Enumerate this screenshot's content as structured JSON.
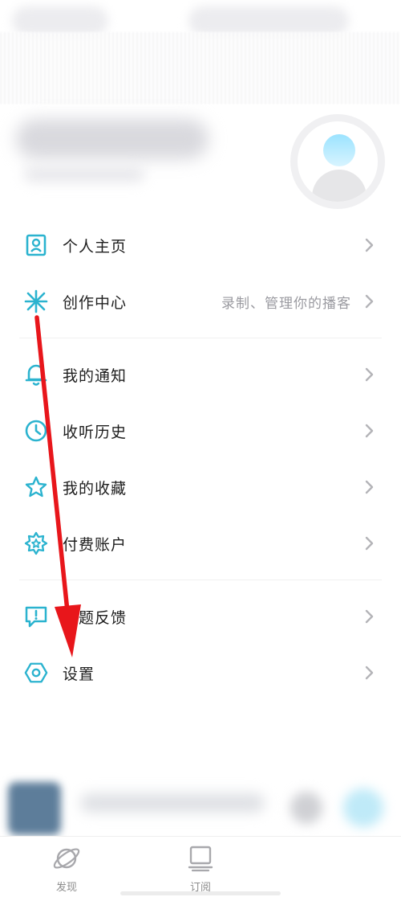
{
  "colors": {
    "accent": "#2bb3cf",
    "text": "#1e1e1e",
    "hint": "#9a9aa0",
    "chevron": "#b4b4b8",
    "annotation": "#e8161b"
  },
  "menu": {
    "group1": [
      {
        "id": "profile",
        "icon": "person-card-icon",
        "label": "个人主页",
        "hint": ""
      },
      {
        "id": "creator",
        "icon": "asterisk-spark-icon",
        "label": "创作中心",
        "hint": "录制、管理你的播客"
      }
    ],
    "group2": [
      {
        "id": "notifications",
        "icon": "bell-icon",
        "label": "我的通知",
        "hint": ""
      },
      {
        "id": "history",
        "icon": "clock-icon",
        "label": "收听历史",
        "hint": ""
      },
      {
        "id": "favorites",
        "icon": "star-icon",
        "label": "我的收藏",
        "hint": ""
      },
      {
        "id": "paid-account",
        "icon": "badge-star-icon",
        "label": "付费账户",
        "hint": ""
      }
    ],
    "group3": [
      {
        "id": "feedback",
        "icon": "feedback-bubble-icon",
        "label": "问题反馈",
        "hint": ""
      },
      {
        "id": "settings",
        "icon": "hexagon-gear-icon",
        "label": "设置",
        "hint": ""
      }
    ]
  },
  "tabbar": [
    {
      "id": "discover",
      "icon": "planet-icon",
      "label": "发现"
    },
    {
      "id": "subscribe",
      "icon": "monitor-icon",
      "label": "订阅"
    }
  ]
}
